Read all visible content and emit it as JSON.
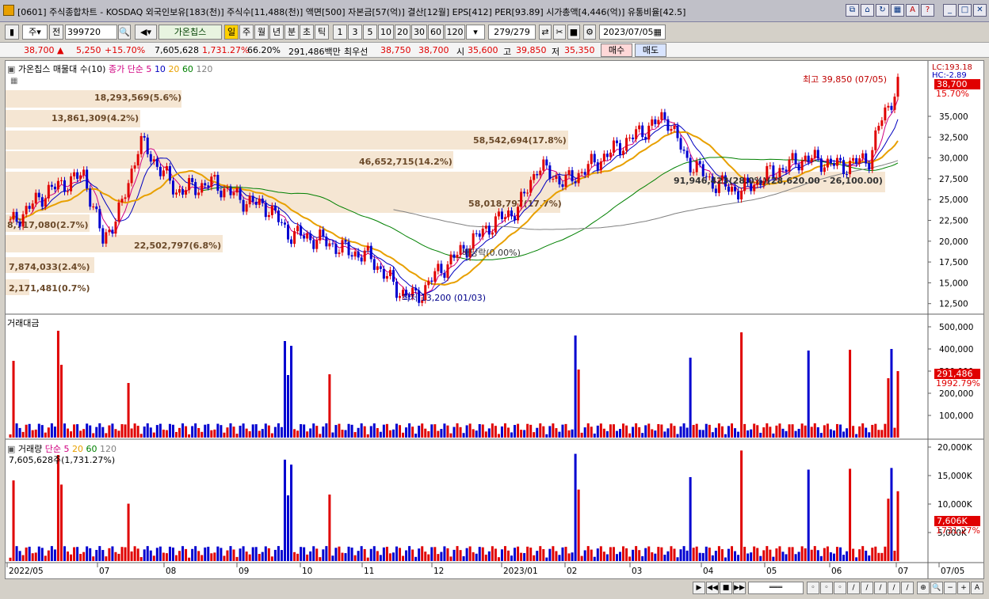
{
  "window": {
    "title": "[0601] 주식종합차트 - KOSDAQ 외국인보유[183(천)] 주식수[11,488(천)] 액면[500] 자본금[57(억)] 결산[12월] EPS[412] PER[93.89] 시가총액[4,446(억)] 유통비율[42.5]"
  },
  "toolbar": {
    "market": "주",
    "type": "전",
    "code": "399720",
    "indicator": "가온칩스",
    "periods": [
      "일",
      "주",
      "월",
      "년",
      "분",
      "초",
      "틱"
    ],
    "intervals": [
      "1",
      "3",
      "5",
      "10",
      "20",
      "30",
      "60",
      "120"
    ],
    "count": "279",
    "count_total": "/279",
    "date": "2023/07/05"
  },
  "info": {
    "price": "38,700",
    "change": "5,250",
    "change_pct": "+15.70%",
    "volume": "7,605,628",
    "volume_pct": "1,731.27%",
    "turnover": "66.20%",
    "amount": "291,486백만",
    "best_label": "최우선",
    "ask": "38,750",
    "bid": "38,700",
    "open_label": "시",
    "open": "35,600",
    "high_label": "고",
    "high": "39,850",
    "low_label": "저",
    "low": "35,350",
    "buy": "매수",
    "sell": "매도"
  },
  "price_panel": {
    "legend_title": "가온칩스 매물대 수(10)",
    "ma_label": "종가 단순 5",
    "ma_periods": [
      "10",
      "20",
      "60",
      "120"
    ],
    "lc": "LC:193.18",
    "hc": "HC:-2.89",
    "current": "38,700",
    "current_pct": "15.70%",
    "high_note": "최고 39,850 (07/05)",
    "low_note": "최저 13,200 (01/03)",
    "dividend": "배당락(0.00%)",
    "box_note": "91,946,423(28.0%)(28,620.00 - 26,100.00)",
    "volume_profile": [
      "18,293,569(5.6%)",
      "13,861,309(4.2%)",
      "58,542,694(17.8%)",
      "46,652,715(14.2%)",
      "58,018,797(17.7%)",
      "8,717,080(2.7%)",
      "22,502,797(6.8%)",
      "7,874,033(2.4%)",
      "2,171,481(0.7%)"
    ],
    "y_ticks": [
      "35,000",
      "32,500",
      "30,000",
      "27,500",
      "25,000",
      "22,500",
      "20,000",
      "17,500",
      "15,000",
      "12,500"
    ]
  },
  "amount_panel": {
    "title": "거래대금",
    "current": "291,486",
    "current_pct": "1992.79%",
    "y_ticks": [
      "500,000",
      "400,000",
      "300,000",
      "200,000",
      "100,000"
    ]
  },
  "volume_panel": {
    "title": "거래량",
    "ma_label": "단순 5",
    "ma_periods": [
      "20",
      "60",
      "120"
    ],
    "current_note": "7,605,628주(1,731.27%)",
    "current": "7,606K",
    "current_pct": "1731.27%",
    "y_ticks": [
      "20,000K",
      "15,000K",
      "10,000K",
      "5,000K"
    ]
  },
  "x_axis": [
    "2022/05",
    "07",
    "08",
    "09",
    "10",
    "11",
    "12",
    "2023/01",
    "02",
    "03",
    "04",
    "05",
    "06",
    "07",
    "07/05"
  ],
  "colors": {
    "up": "#e00000",
    "down": "#0000d0",
    "ma5": "#d00080",
    "ma10": "#0000c0",
    "ma20": "#e8a000",
    "ma60": "#008000",
    "ma120": "#808080",
    "profile": "#f5e6d3"
  }
}
